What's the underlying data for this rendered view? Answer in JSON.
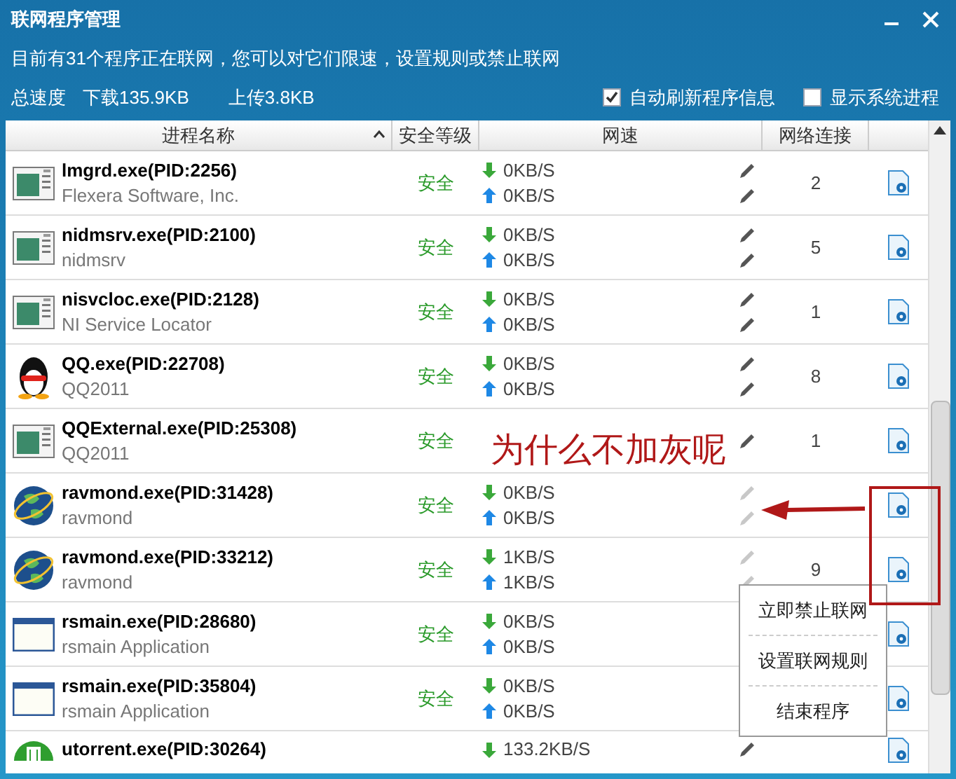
{
  "window": {
    "title": "联网程序管理"
  },
  "info": {
    "message": "目前有31个程序正在联网，您可以对它们限速，设置规则或禁止联网",
    "total_label": "总速度",
    "download": "下载135.9KB",
    "upload": "上传3.8KB"
  },
  "options": [
    {
      "label": "自动刷新程序信息",
      "checked": true
    },
    {
      "label": "显示系统进程",
      "checked": false
    }
  ],
  "table": {
    "columns": [
      "进程名称",
      "安全等级",
      "网速",
      "网络连接"
    ],
    "rows": [
      {
        "kind": "app",
        "name": "lmgrd.exe(PID:2256)",
        "desc": "Flexera Software, Inc.",
        "safety": "安全",
        "down": "0KB/S",
        "up": "0KB/S",
        "edit_disabled": false,
        "connections": "2"
      },
      {
        "kind": "app",
        "name": "nidmsrv.exe(PID:2100)",
        "desc": "nidmsrv",
        "safety": "安全",
        "down": "0KB/S",
        "up": "0KB/S",
        "edit_disabled": false,
        "connections": "5"
      },
      {
        "kind": "app",
        "name": "nisvcloc.exe(PID:2128)",
        "desc": "NI Service Locator",
        "safety": "安全",
        "down": "0KB/S",
        "up": "0KB/S",
        "edit_disabled": false,
        "connections": "1"
      },
      {
        "kind": "penguin",
        "name": "QQ.exe(PID:22708)",
        "desc": "QQ2011",
        "safety": "安全",
        "down": "0KB/S",
        "up": "0KB/S",
        "edit_disabled": false,
        "connections": "8"
      },
      {
        "kind": "app",
        "name": "QQExternal.exe(PID:25308)",
        "desc": "QQ2011",
        "safety": "安全",
        "edit_disabled": false,
        "connections": "1"
      },
      {
        "kind": "globe",
        "name": "ravmond.exe(PID:31428)",
        "desc": "ravmond",
        "safety": "安全",
        "down": "0KB/S",
        "up": "0KB/S",
        "edit_disabled": true
      },
      {
        "kind": "globe",
        "name": "ravmond.exe(PID:33212)",
        "desc": "ravmond",
        "safety": "安全",
        "down": "1KB/S",
        "up": "1KB/S",
        "edit_disabled": true,
        "connections": "9"
      },
      {
        "kind": "window",
        "name": "rsmain.exe(PID:28680)",
        "desc": "rsmain Application",
        "safety": "安全",
        "down": "0KB/S",
        "up": "0KB/S"
      },
      {
        "kind": "window",
        "name": "rsmain.exe(PID:35804)",
        "desc": "rsmain Application",
        "safety": "安全",
        "down": "0KB/S",
        "up": "0KB/S"
      },
      {
        "kind": "torrent",
        "name": "utorrent.exe(PID:30264)",
        "down": "133.2KB/S",
        "edit_disabled": false
      }
    ]
  },
  "context_menu": [
    "立即禁止联网",
    "设置联网规则",
    "结束程序"
  ],
  "annotation": {
    "text": "为什么不加灰呢"
  }
}
